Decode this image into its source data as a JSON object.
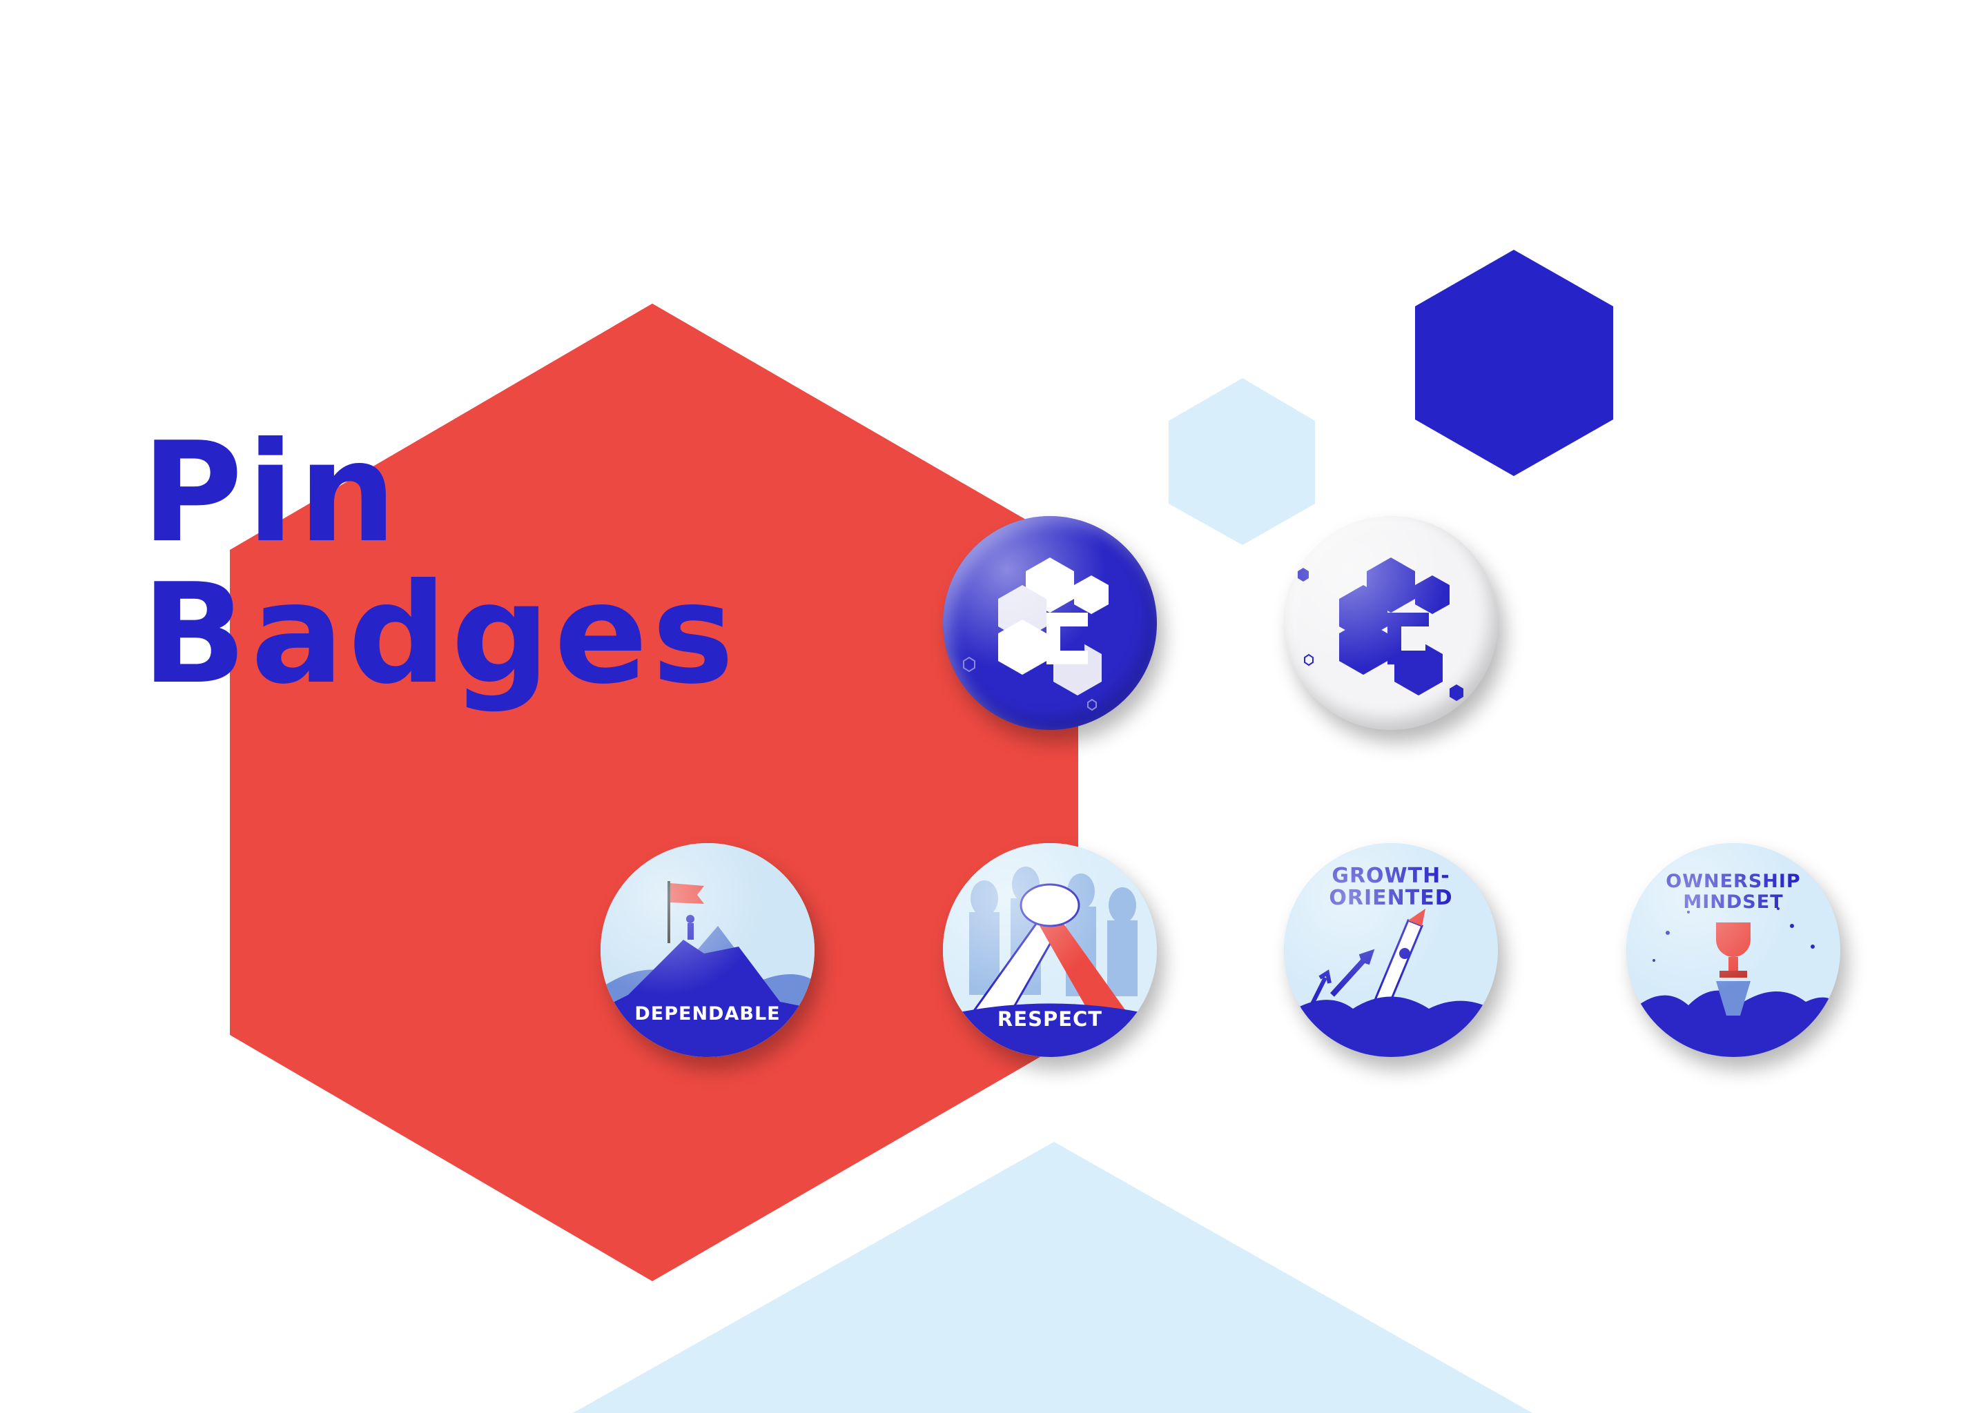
{
  "title": {
    "line1": "Pin",
    "line2": "Badges"
  },
  "colors": {
    "brand_blue": "#2623c8",
    "accent_red": "#ec4942",
    "light_blue": "#d8eefb"
  },
  "badges": [
    {
      "label": "",
      "icon": "c-hex-logo-icon",
      "variant": "blue"
    },
    {
      "label": "",
      "icon": "c-hex-logo-icon",
      "variant": "white"
    },
    {
      "label": "DEPENDABLE",
      "icon": "flag-mountain-icon"
    },
    {
      "label": "RESPECT",
      "icon": "handshake-icon"
    },
    {
      "label": "GROWTH-\nORIENTED",
      "line1": "GROWTH-",
      "line2": "ORIENTED",
      "icon": "rocket-icon"
    },
    {
      "label": "OWNERSHIP\nMINDSET",
      "line1": "OWNERSHIP",
      "line2": "MINDSET",
      "icon": "trophy-icon"
    }
  ]
}
